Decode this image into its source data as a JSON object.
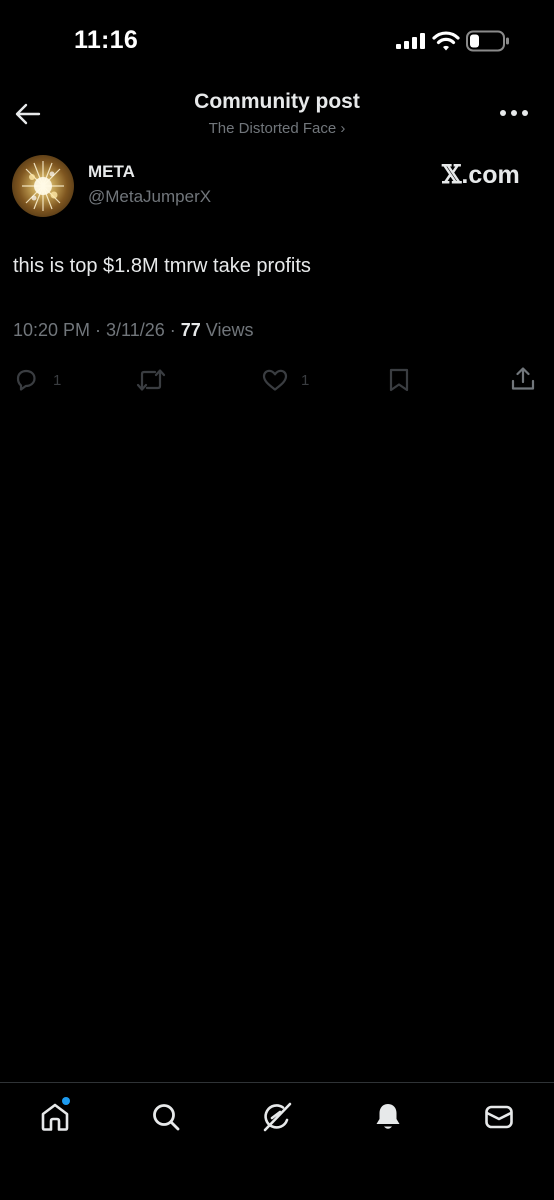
{
  "status_bar": {
    "time": "11:16"
  },
  "header": {
    "title": "Community post",
    "subtitle": "The Distorted Face ›"
  },
  "post": {
    "author_name": "META",
    "author_handle": "@MetaJumperX",
    "watermark_x": "𝕏",
    "watermark_suffix": ".com",
    "text": "this is top $1.8M tmrw take profits",
    "timestamp": "10:20 PM · 3/11/26 · ",
    "views_count": "77",
    "views_label": " Views"
  },
  "actions": {
    "reply_count": "1",
    "like_count": "1"
  },
  "icons": {
    "back": "arrow-left-icon",
    "more": "more-horizontal-icon",
    "reply": "reply-icon",
    "repost": "repost-icon",
    "like": "heart-icon",
    "bookmark": "bookmark-icon",
    "share": "share-icon",
    "nav_home": "home-icon",
    "nav_search": "search-icon",
    "nav_grok": "grok-icon",
    "nav_notifications": "bell-icon",
    "nav_messages": "mail-icon"
  },
  "colors": {
    "background": "#000000",
    "text_primary": "#e7e9ea",
    "text_secondary": "#71767b",
    "action_muted": "#3a3d41",
    "accent": "#1d9bf0",
    "divider": "#2f3336"
  }
}
